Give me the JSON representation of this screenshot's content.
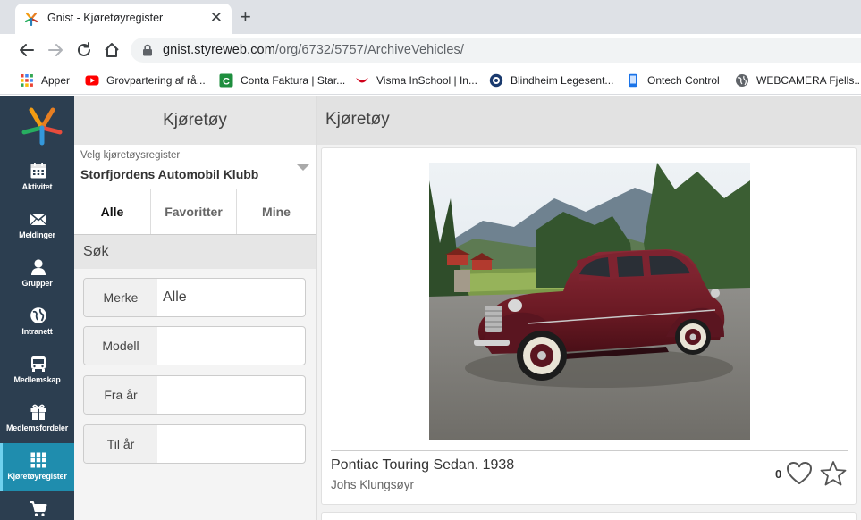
{
  "browser": {
    "tab_title": "Gnist - Kjøretøyregister",
    "url_host": "gnist.styreweb.com",
    "url_path": "/org/6732/5757/ArchiveVehicles/",
    "bookmarks": [
      {
        "label": "Apper",
        "icon": "apps-grid-icon"
      },
      {
        "label": "Grovpartering af rå...",
        "icon": "youtube-icon"
      },
      {
        "label": "Conta Faktura | Star...",
        "icon": "conta-icon"
      },
      {
        "label": "Visma InSchool | In...",
        "icon": "visma-icon"
      },
      {
        "label": "Blindheim Legesent...",
        "icon": "globe-badge-icon"
      },
      {
        "label": "Ontech Control",
        "icon": "phone-icon"
      },
      {
        "label": "WEBCAMERA Fjells...",
        "icon": "globe-icon"
      }
    ]
  },
  "sidebar": {
    "items": [
      {
        "label": "Aktivitet",
        "icon": "calendar-icon"
      },
      {
        "label": "Meldinger",
        "icon": "envelope-icon"
      },
      {
        "label": "Grupper",
        "icon": "user-icon"
      },
      {
        "label": "Intranett",
        "icon": "globe-icon"
      },
      {
        "label": "Medlemskap",
        "icon": "bus-icon"
      },
      {
        "label": "Medlemsfordeler",
        "icon": "gift-icon"
      },
      {
        "label": "Kjøretøyregister",
        "icon": "grid-icon",
        "active": true
      },
      {
        "label": "",
        "icon": "cart-icon"
      }
    ]
  },
  "filter": {
    "header": "Kjøretøy",
    "registry_label": "Velg kjøretøysregister",
    "registry_value": "Storfjordens Automobil Klubb",
    "tabs": [
      "Alle",
      "Favoritter",
      "Mine"
    ],
    "active_tab": "Alle",
    "search_header": "Søk",
    "fields": [
      {
        "label": "Merke",
        "value": "Alle"
      },
      {
        "label": "Modell",
        "value": ""
      },
      {
        "label": "Fra år",
        "value": ""
      },
      {
        "label": "Til år",
        "value": ""
      }
    ]
  },
  "main": {
    "header": "Kjøretøy",
    "vehicle": {
      "title": "Pontiac Touring Sedan. 1938",
      "owner": "Johs Klungsøyr",
      "likes": "0"
    }
  },
  "colors": {
    "sidebar_bg": "#2c3e50",
    "sidebar_active": "#1f8dae",
    "car_paint": "#6b1a24"
  }
}
